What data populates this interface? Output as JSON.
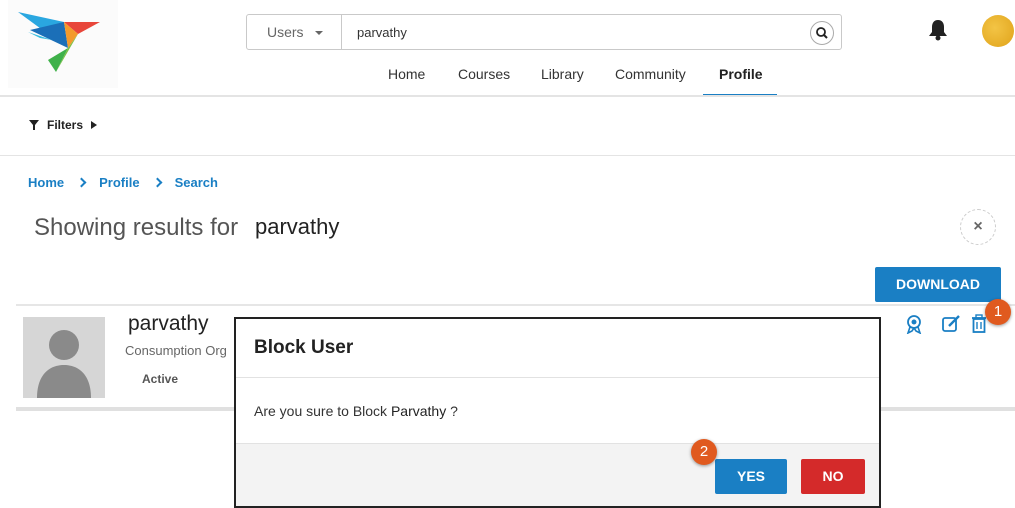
{
  "header": {
    "search_scope": "Users",
    "search_query": "parvathy",
    "nav": [
      "Home",
      "Courses",
      "Library",
      "Community",
      "Profile"
    ],
    "active_nav": "Profile"
  },
  "filters": {
    "label": "Filters"
  },
  "breadcrumb": [
    "Home",
    "Profile",
    "Search"
  ],
  "results": {
    "label": "Showing results for",
    "query": "parvathy",
    "close_symbol": "×"
  },
  "download_label": "DOWNLOAD",
  "user": {
    "name": "parvathy",
    "org": "Consumption Org",
    "status": "Active"
  },
  "markers": {
    "first": "1",
    "second": "2"
  },
  "modal": {
    "title": "Block User",
    "message_prefix": "Are you sure to Block",
    "user": "Parvathy",
    "message_suffix": "?",
    "yes_label": "YES",
    "no_label": "NO"
  },
  "colors": {
    "accent": "#1a7fc4",
    "danger": "#d42a2a",
    "marker": "#e05a1f"
  },
  "icons": [
    "logo-bird-icon",
    "search-icon",
    "bell-icon",
    "filter-icon",
    "badge-icon",
    "edit-icon",
    "trash-icon"
  ]
}
